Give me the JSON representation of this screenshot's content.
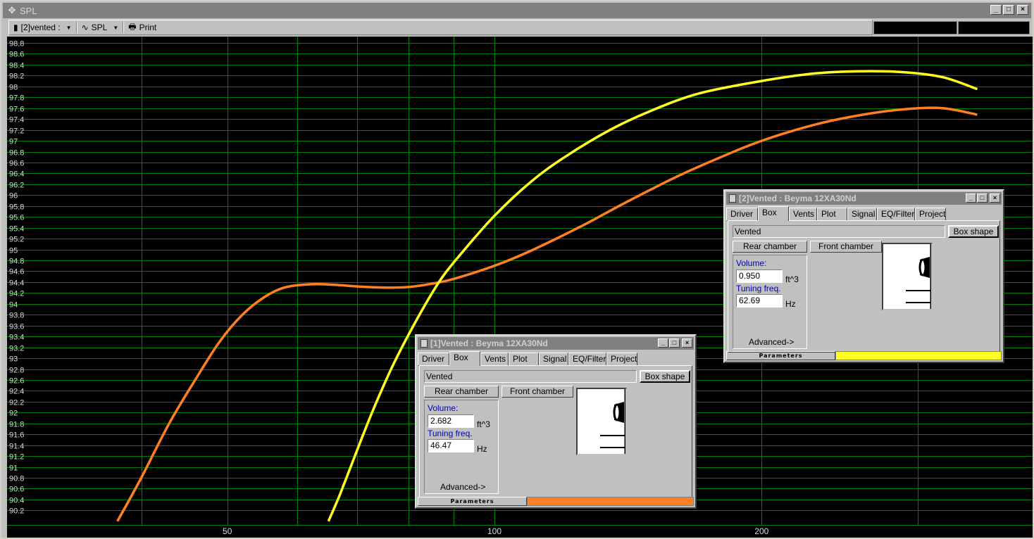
{
  "window": {
    "title": "SPL",
    "buttons": [
      "_",
      "□",
      "×"
    ]
  },
  "toolbar": {
    "project_label": "[2]vented :",
    "graph_label": "SPL",
    "print_label": "Print"
  },
  "colors": {
    "series_1": "#ff8020",
    "series_2": "#ffff20",
    "grid": "#008000",
    "background": "#000000"
  },
  "chart_data": {
    "type": "line",
    "title": "",
    "xlabel": "",
    "ylabel": "",
    "x_scale": "log",
    "xlim": [
      20,
      350
    ],
    "ylim": [
      90.0,
      98.9
    ],
    "y_ticks": [
      "98.8",
      "98.6",
      "98.4",
      "98.2",
      "98",
      "97.8",
      "97.6",
      "97.4",
      "97.2",
      "97",
      "96.8",
      "96.6",
      "96.4",
      "96.2",
      "96",
      "95.8",
      "95.6",
      "95.4",
      "95.2",
      "95",
      "94.8",
      "94.6",
      "94.4",
      "94.2",
      "94",
      "93.8",
      "93.6",
      "93.4",
      "93.2",
      "93",
      "92.8",
      "92.6",
      "92.4",
      "92.2",
      "92",
      "91.8",
      "91.6",
      "91.4",
      "91.2",
      "91",
      "90.8",
      "90.6",
      "90.4",
      "90.2"
    ],
    "x_ticks": [
      "50",
      "100",
      "200"
    ],
    "grid": true,
    "series": [
      {
        "x": [
          37.6,
          40,
          43,
          46,
          49,
          52,
          55,
          58,
          62,
          66,
          70,
          75,
          80,
          85,
          90,
          100,
          110,
          125,
          140,
          160,
          180,
          200,
          230,
          260,
          290,
          320,
          350
        ],
        "y": [
          90.0,
          90.8,
          91.8,
          92.6,
          93.3,
          93.8,
          94.12,
          94.3,
          94.36,
          94.35,
          94.32,
          94.3,
          94.31,
          94.37,
          94.46,
          94.7,
          94.98,
          95.42,
          95.85,
          96.33,
          96.7,
          97.0,
          97.3,
          97.48,
          97.58,
          97.6,
          97.48
        ]
      },
      {
        "x": [
          65,
          67,
          70,
          73,
          77,
          82,
          87,
          92,
          100,
          110,
          120,
          135,
          150,
          170,
          200,
          230,
          260,
          290,
          320,
          350
        ],
        "y": [
          90.0,
          90.5,
          91.3,
          92.05,
          92.9,
          93.75,
          94.45,
          94.95,
          95.62,
          96.25,
          96.7,
          97.2,
          97.55,
          97.87,
          98.1,
          98.24,
          98.28,
          98.26,
          98.17,
          97.95
        ]
      }
    ]
  },
  "child_windows": [
    {
      "title": "[1]Vented : Beyma  12XA30Nd",
      "tabs": [
        "Driver",
        "Box",
        "Vents",
        "Plot",
        "Signal",
        "EQ/Filter",
        "Project"
      ],
      "active_tab": "Box",
      "box_type": "Vented",
      "box_shape_button": "Box shape",
      "rear_chamber_button": "Rear chamber",
      "front_chamber_button": "Front chamber",
      "volume_label": "Volume:",
      "volume_value": "2.682",
      "volume_unit": "ft^3",
      "tuning_label": "Tuning freq.",
      "tuning_value": "46.47",
      "tuning_unit": "Hz",
      "advanced_label": "Advanced->",
      "status_label": "Parameters",
      "color": "#ff8020"
    },
    {
      "title": "[2]Vented : Beyma  12XA30Nd",
      "tabs": [
        "Driver",
        "Box",
        "Vents",
        "Plot",
        "Signal",
        "EQ/Filter",
        "Project"
      ],
      "active_tab": "Box",
      "box_type": "Vented",
      "box_shape_button": "Box shape",
      "rear_chamber_button": "Rear chamber",
      "front_chamber_button": "Front chamber",
      "volume_label": "Volume:",
      "volume_value": "0.950",
      "volume_unit": "ft^3",
      "tuning_label": "Tuning freq.",
      "tuning_value": "62.69",
      "tuning_unit": "Hz",
      "advanced_label": "Advanced->",
      "status_label": "Parameters",
      "color": "#ffff20"
    }
  ]
}
